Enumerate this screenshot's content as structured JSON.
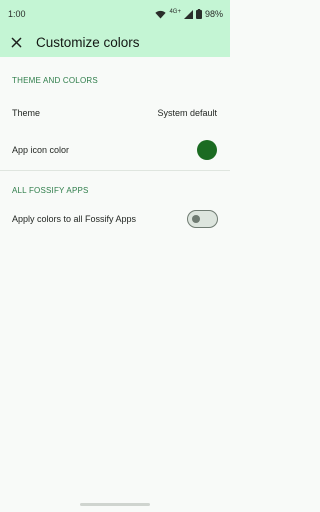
{
  "status_bar": {
    "time": "1:00",
    "network": "4G+",
    "battery": "98%"
  },
  "app_bar": {
    "title": "Customize colors",
    "close_icon": "close-icon"
  },
  "sections": {
    "theme_and_colors": {
      "header": "THEME AND COLORS",
      "theme_label": "Theme",
      "theme_value": "System default",
      "app_icon_color_label": "App icon color",
      "app_icon_color": "#1b6b22"
    },
    "all_fossify_apps": {
      "header": "ALL FOSSIFY APPS",
      "apply_label": "Apply colors to all Fossify Apps",
      "apply_enabled": false
    }
  },
  "colors": {
    "accent": "#2e7d4a",
    "app_bar_bg": "#c4f5d4",
    "background": "#f8faf8"
  }
}
